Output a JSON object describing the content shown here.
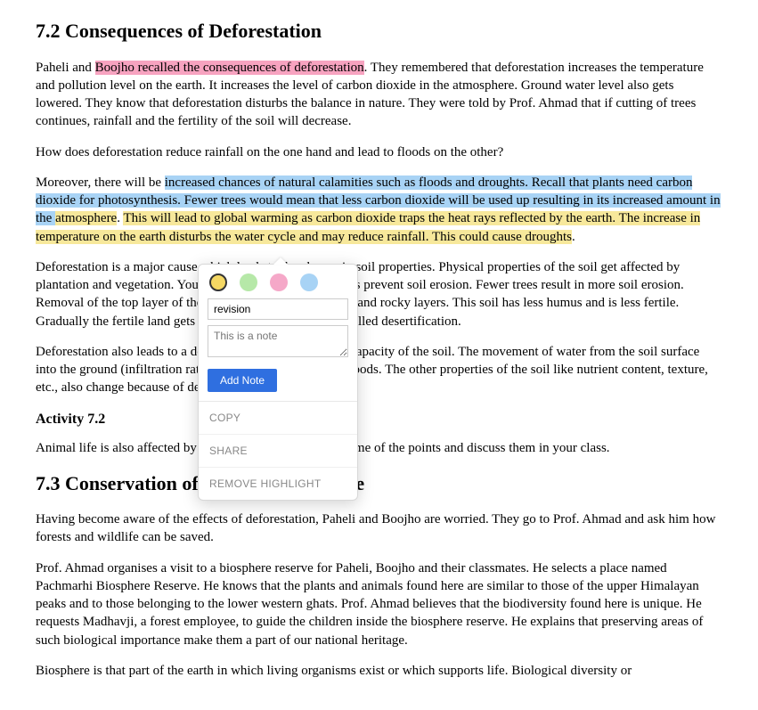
{
  "section72": {
    "heading": "7.2 Consequences of Deforestation",
    "p1_a": "Paheli and ",
    "p1_hl": "Boojho recalled the consequences of deforestation",
    "p1_b": ". They remembered that deforestation increases the temperature and pollution level on the earth. It increases the level of carbon dioxide in the atmosphere. Ground water level also gets lowered. They know that deforestation disturbs the balance in nature. They were told by Prof. Ahmad that if cutting of trees continues, rainfall and the fertility of the soil will decrease.",
    "p2": "How does deforestation reduce rainfall on the one hand and lead to floods on the other?",
    "p3_a": "Moreover, there will be ",
    "p3_hl_blue": "increased chances of natural calamities such as floods and droughts. Recall that plants need carbon dioxide for photosynthesis. Fewer trees would mean that less carbon dioxide will be used up resulting in its increased amount in the ",
    "p3_hl_yel1": "atmosphere",
    "p3_mid": ". ",
    "p3_hl_yel2": "This will lead to global warming as carbon dioxide traps the heat rays reflected by the earth. The increase in temperature on the earth disturbs the water cycle and may reduce rainfall. This could cause droughts",
    "p3_b": ".",
    "p4": "Deforestation is a major cause which leads to the change in soil properties. Physical properties of the soil get affected by plantation and vegetation. You have learnt how roots of trees prevent soil erosion. Fewer trees result in more soil erosion. Removal of the top layer of the soil exposes the lower, hard and rocky layers. This soil has less humus and is less fertile. Gradually the fertile land gets converted into deserts. It is called desertification.",
    "p5": "Deforestation also leads to a decrease in the water holding capacity of the soil. The movement of water from the soil surface into the ground (infiltration rate) is reduced. So, there are floods. The other properties of the soil like nutrient content, texture, etc., also change because of deforestation.",
    "activity_heading": "Activity 7.2",
    "p6": "Animal life is also affected by deforestation. Write down some of the points and discuss them in your class."
  },
  "section73": {
    "heading": "7.3 Conservation of Forest and Wildlife",
    "p1": "Having become aware of the effects of deforestation, Paheli and Boojho are worried. They go to Prof. Ahmad and ask him how forests and wildlife can be saved.",
    "p2": "Prof. Ahmad organises a visit to a biosphere reserve for Paheli, Boojho and their classmates. He selects a place named Pachmarhi Biosphere Reserve. He knows that the plants and animals found here are similar to those of the upper Himalayan peaks and to those belonging to the lower western ghats. Prof. Ahmad believes that the biodiversity found here is unique. He requests Madhavji, a forest employee, to guide the children inside the biosphere reserve. He explains that preserving areas of such biological importance make them a part of our national heritage.",
    "p3": "Biosphere is that part of the earth in which living organisms exist or which supports life. Biological diversity or"
  },
  "popup": {
    "tag_value": "revision",
    "note_placeholder": "This is a note",
    "add_btn": "Add Note",
    "menu": {
      "copy": "COPY",
      "share": "SHARE",
      "remove": "REMOVE HIGHLIGHT"
    }
  }
}
